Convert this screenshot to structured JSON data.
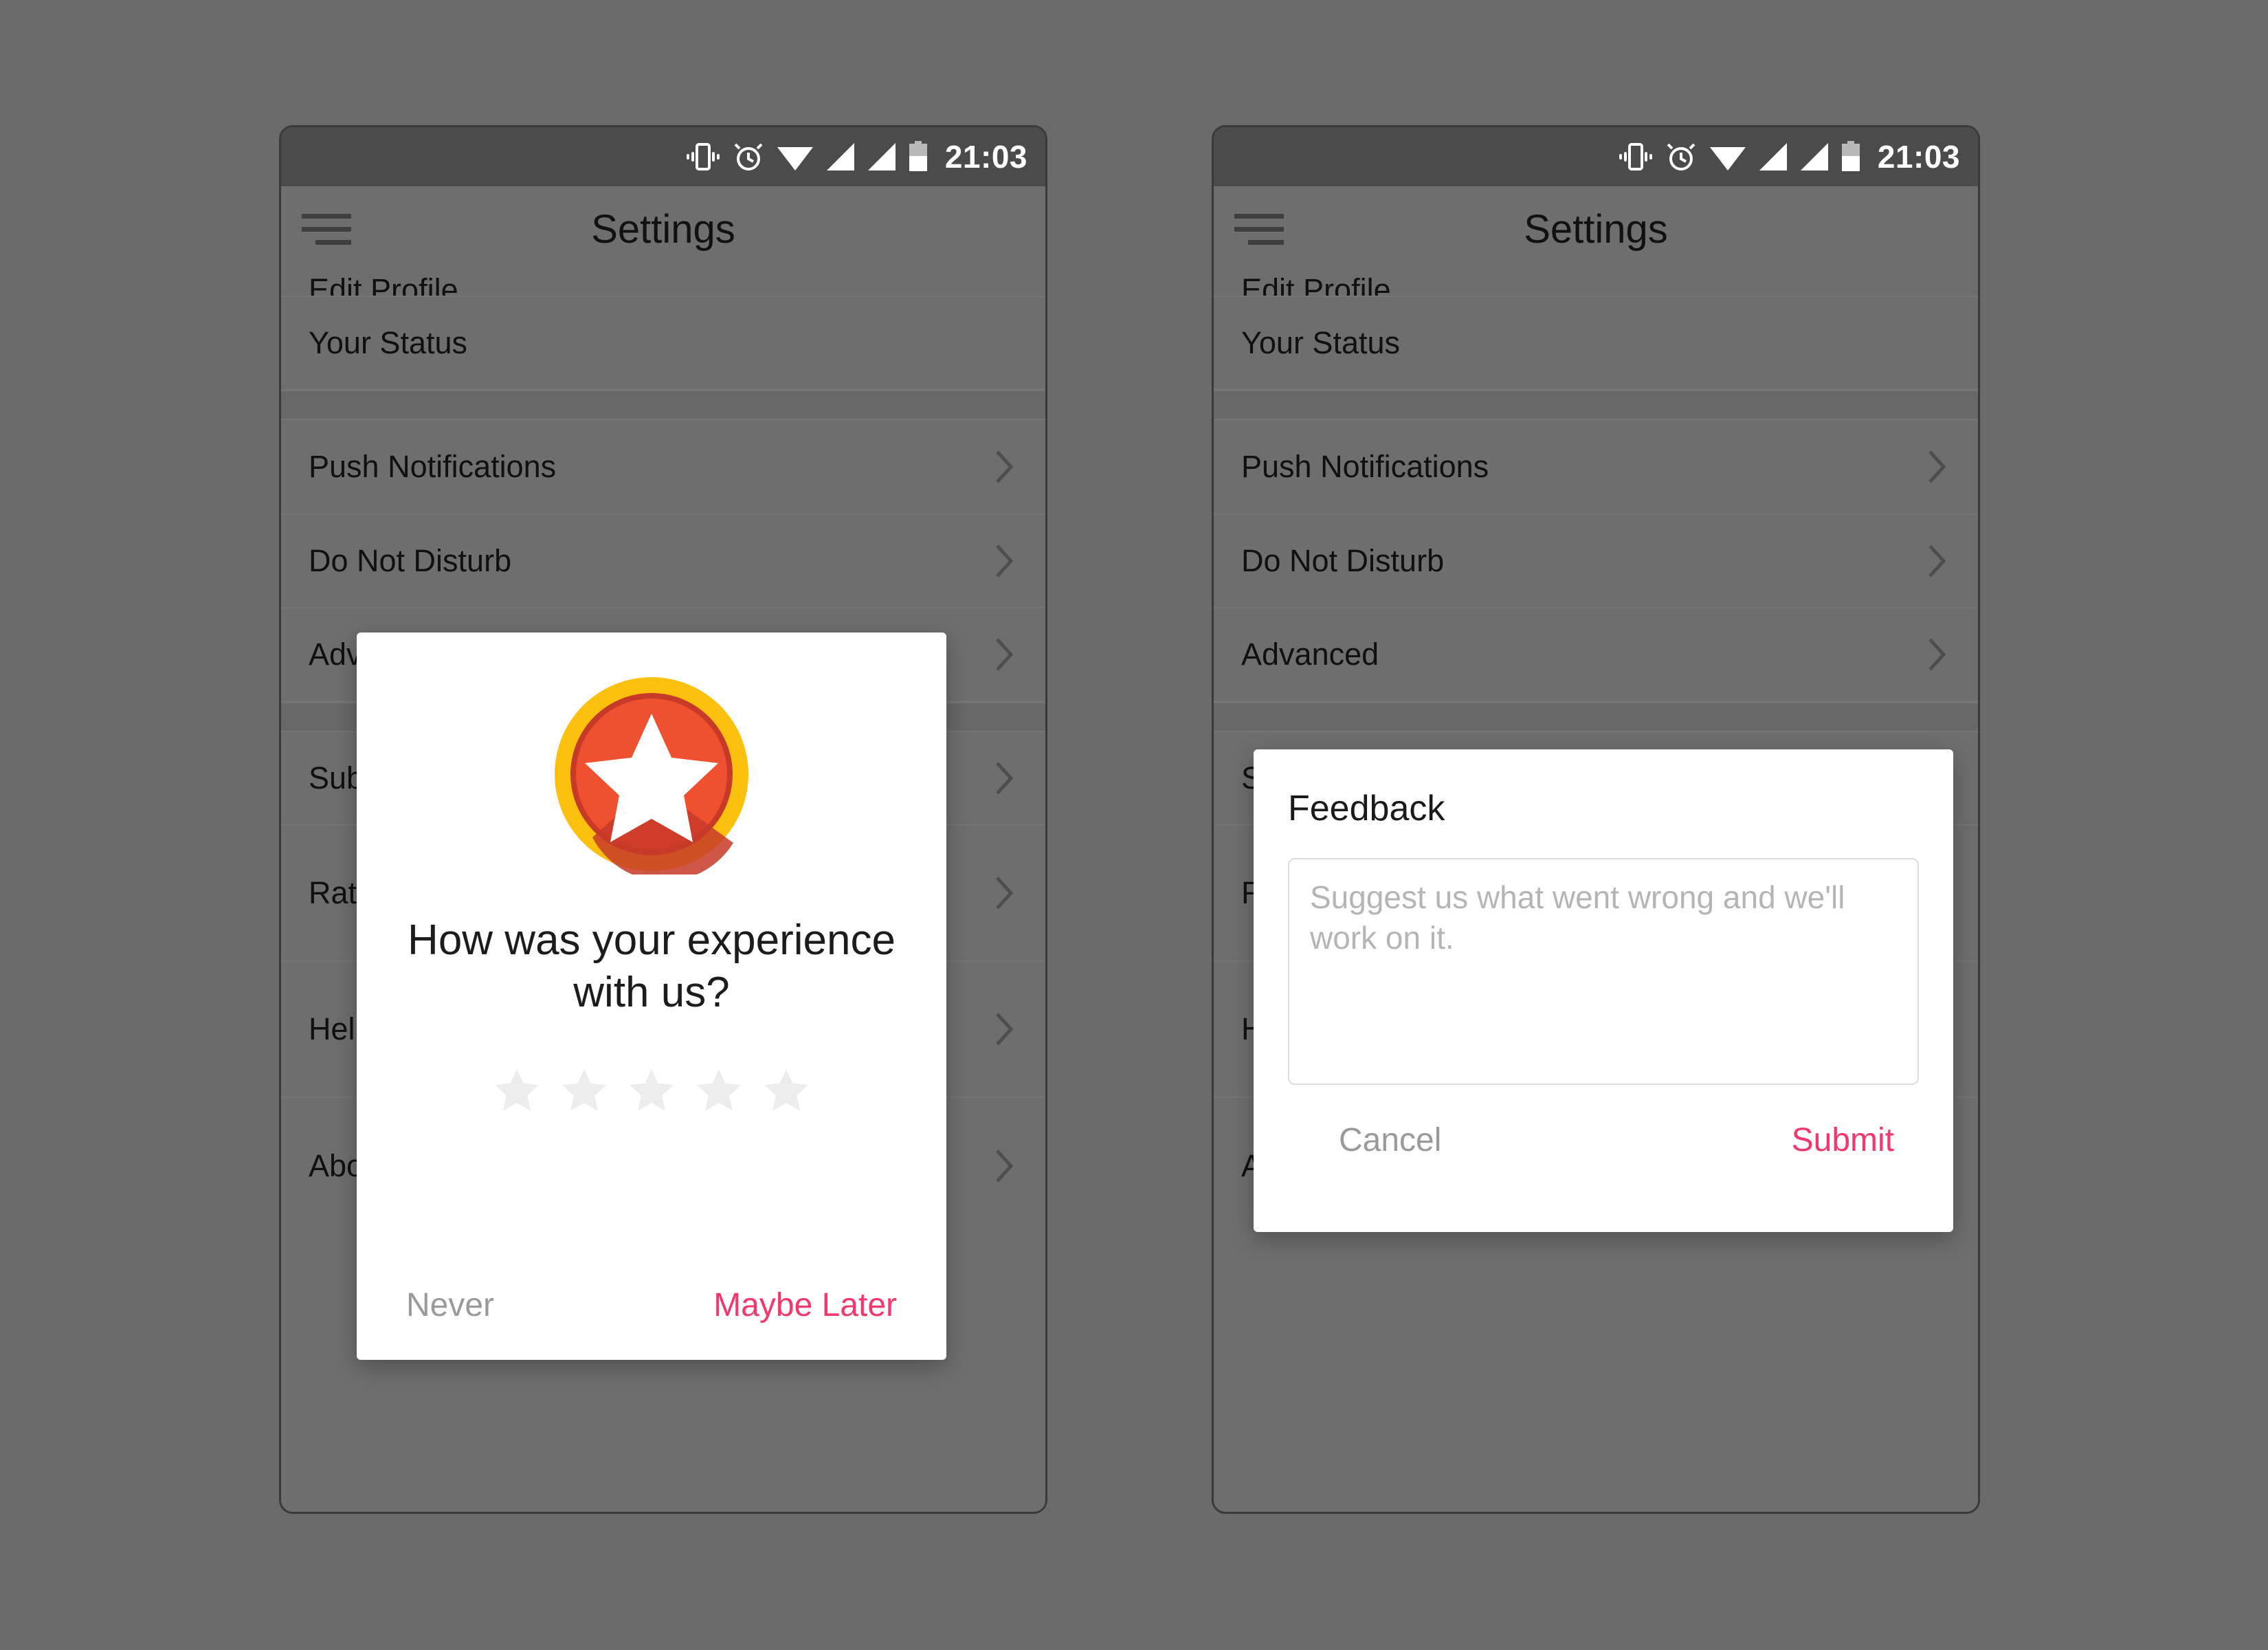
{
  "accent_color": "#f4376d",
  "status_bar": {
    "time": "21:03",
    "icons": [
      "vibrate-icon",
      "alarm-icon",
      "wifi-icon",
      "signal-icon",
      "signal-icon",
      "battery-icon"
    ],
    "battery_level_percent": 50
  },
  "app_bar": {
    "menu_icon": "hamburger-menu-icon",
    "title": "Settings"
  },
  "settings_list": {
    "items": [
      {
        "label": "Edit Profile",
        "chevron": false
      },
      {
        "label": "Your Status",
        "chevron": false
      },
      {
        "label": "Push Notifications",
        "chevron": true
      },
      {
        "label": "Do Not Disturb",
        "chevron": true
      },
      {
        "label": "Advanced",
        "chevron": true
      },
      {
        "label": "Submit Feedback",
        "chevron": true
      },
      {
        "label": "Rate Us",
        "chevron": true
      },
      {
        "label": "Help",
        "chevron": true
      },
      {
        "label": "About",
        "chevron": true
      }
    ]
  },
  "rating_dialog": {
    "badge_icon": "star-badge-icon",
    "badge_colors": {
      "ring": "#fcc10f",
      "inner_ring": "#c73a28",
      "fill": "#ef5130",
      "star": "#ffffff"
    },
    "question": "How was your experience with us?",
    "stars": {
      "count": 5,
      "selected": 0,
      "empty_color": "#ededed"
    },
    "negative_label": "Never",
    "positive_label": "Maybe Later"
  },
  "feedback_dialog": {
    "title": "Feedback",
    "placeholder": "Suggest us what went wrong and we'll work on it.",
    "value": "",
    "cancel_label": "Cancel",
    "submit_label": "Submit"
  }
}
